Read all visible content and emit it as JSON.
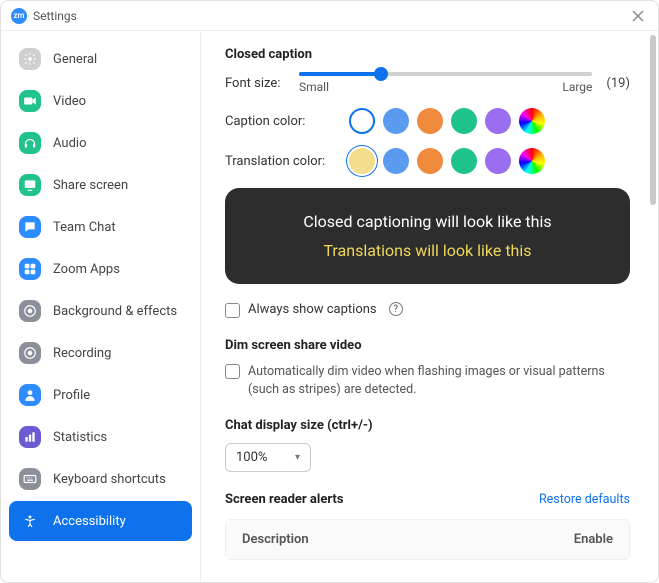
{
  "window": {
    "app_icon_text": "zm",
    "title": "Settings"
  },
  "sidebar": {
    "items": [
      {
        "label": "General",
        "icon_bg": "#d0d0d0"
      },
      {
        "label": "Video",
        "icon_bg": "#22c28c"
      },
      {
        "label": "Audio",
        "icon_bg": "#22c28c"
      },
      {
        "label": "Share screen",
        "icon_bg": "#22c28c"
      },
      {
        "label": "Team Chat",
        "icon_bg": "#2d8cff"
      },
      {
        "label": "Zoom Apps",
        "icon_bg": "#2d8cff"
      },
      {
        "label": "Background & effects",
        "icon_bg": "#8a8f98"
      },
      {
        "label": "Recording",
        "icon_bg": "#8a8f98"
      },
      {
        "label": "Profile",
        "icon_bg": "#2d8cff"
      },
      {
        "label": "Statistics",
        "icon_bg": "#6b5bd2"
      },
      {
        "label": "Keyboard shortcuts",
        "icon_bg": "#8a8f98"
      },
      {
        "label": "Accessibility",
        "icon_bg": "#0e72ed",
        "active": true
      }
    ]
  },
  "accessibility": {
    "closed_caption": {
      "heading": "Closed caption",
      "font_size_label": "Font size:",
      "font_size_value": "(19)",
      "small_label": "Small",
      "large_label": "Large",
      "caption_color_label": "Caption color:",
      "translation_color_label": "Translation color:",
      "caption_colors": [
        "#ffffff",
        "#5a9bf0",
        "#f08a3c",
        "#1ec28c",
        "#9b6ef0",
        "rainbow"
      ],
      "translation_colors": [
        "#f3dd8e",
        "#5a9bf0",
        "#f08a3c",
        "#1ec28c",
        "#9b6ef0",
        "rainbow"
      ],
      "preview_caption": "Closed captioning will look like this",
      "preview_translation": "Translations will look like this",
      "always_show_label": "Always show captions"
    },
    "dim": {
      "heading": "Dim screen share video",
      "desc": "Automatically dim video when flashing images or visual patterns (such as stripes) are detected."
    },
    "chat_size": {
      "heading": "Chat display size (ctrl+/-)",
      "value": "100%"
    },
    "screen_reader": {
      "heading": "Screen reader alerts",
      "restore": "Restore defaults",
      "col_description": "Description",
      "col_enable": "Enable"
    }
  }
}
